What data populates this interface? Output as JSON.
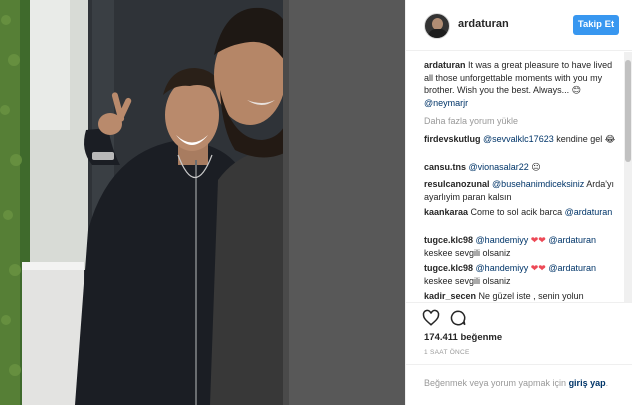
{
  "post": {
    "username": "ardaturan",
    "follow_label": "Takip Et",
    "caption_user": "ardaturan",
    "caption_text": " It was a great pleasure to have lived all those unforgettable moments with you my brother. Wish you the best. Always... 😊 ",
    "caption_mention": "@neymarjr",
    "load_more": "Daha fazla yorum yükle",
    "likes": "174.411 beğenme",
    "time": "1 SAAT ÖNCE",
    "add_comment_text": "Beğenmek veya yorum yapmak için ",
    "login_label": "giriş yap",
    "add_comment_end": "."
  },
  "comments": [
    {
      "user": "firdevskutlug",
      "mention": "@sevvalklc17623",
      "text": " kendine gel 😂"
    },
    {
      "user": "cansu.tns",
      "mention": "@vionasalar22",
      "text": " 😐"
    },
    {
      "user": "resulcanozunal",
      "mention": "@busehanimdiceksiniz",
      "text": " Arda'yı ayarlıyim paran kalsın"
    },
    {
      "user": "kaankaraa",
      "mention": "@ardaturan",
      "text": " Come to sol acik barca "
    },
    {
      "user": "tugce.klc98",
      "mention": "@handemiyy",
      "text": " ❤❤ ",
      "mention2": "@ardaturan",
      "text2": " keskee sevgili olsaniz"
    },
    {
      "user": "tugce.klc98",
      "mention": "@handemiyy",
      "text": " ❤❤ ",
      "mention2": "@ardaturan",
      "text2": " keskee sevgili olsaniz"
    },
    {
      "user": "kadir_secen",
      "mention": "",
      "text": " Ne güzel iste , senin yolun"
    }
  ],
  "colors": {
    "accent": "#3897f0",
    "link": "#003569",
    "muted": "#999999"
  },
  "icons": {
    "like": "heart-icon",
    "comment": "comment-icon"
  }
}
